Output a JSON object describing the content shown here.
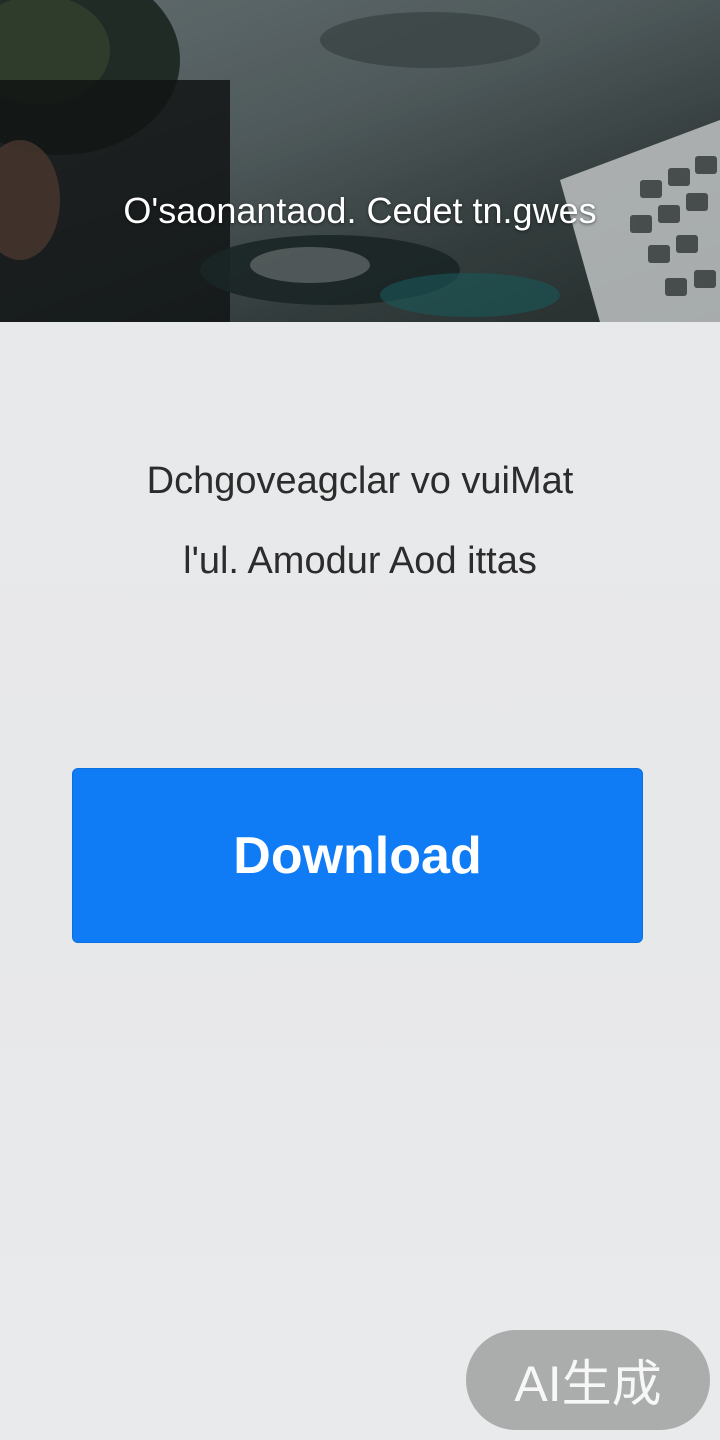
{
  "hero": {
    "title": "O'saonantaod. Cedet tn.gwes"
  },
  "description": {
    "line1": "Dchgoveagclar vo vuiMat",
    "line2": "l'ul. Amodur Aod ittas"
  },
  "download_button": {
    "label": "Download"
  },
  "watermark": {
    "label": "AI生成"
  },
  "colors": {
    "accent": "#0f7cf5",
    "background": "#e8e9eb"
  }
}
